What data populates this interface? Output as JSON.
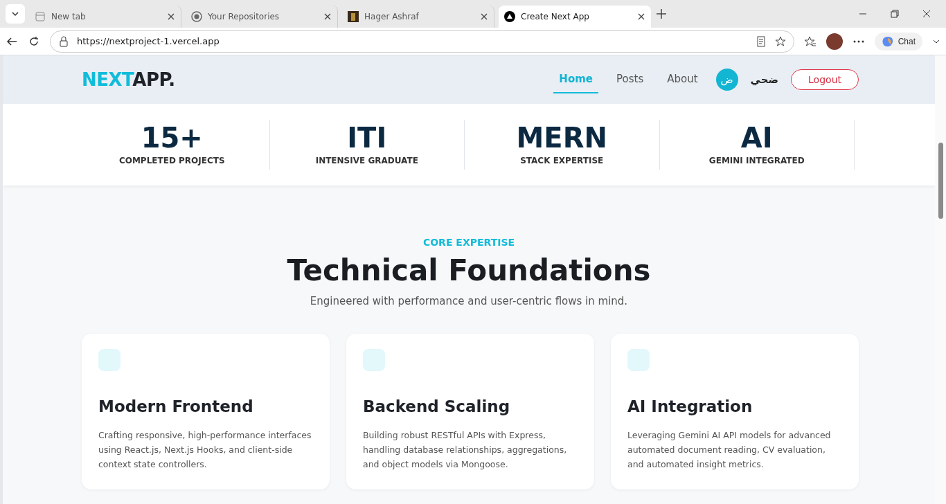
{
  "browser": {
    "tabs": [
      {
        "title": "New tab",
        "selected": false
      },
      {
        "title": "Your Repositories",
        "selected": false
      },
      {
        "title": "Hager Ashraf",
        "selected": false
      },
      {
        "title": "Create Next App",
        "selected": true
      }
    ],
    "url": "https://nextproject-1.vercel.app",
    "chat_label": "Chat"
  },
  "header": {
    "logo_accent": "NEXT",
    "logo_rest": "APP.",
    "nav": [
      {
        "label": "Home",
        "selected": true
      },
      {
        "label": "Posts",
        "selected": false
      },
      {
        "label": "About",
        "selected": false
      }
    ],
    "avatar_letter": "ض",
    "user_name": "ضحي",
    "logout": "Logout"
  },
  "stats": [
    {
      "value": "15+",
      "label": "COMPLETED PROJECTS"
    },
    {
      "value": "ITI",
      "label": "INTENSIVE GRADUATE"
    },
    {
      "value": "MERN",
      "label": "STACK EXPERTISE"
    },
    {
      "value": "AI",
      "label": "GEMINI INTEGRATED"
    }
  ],
  "section": {
    "eyebrow": "CORE EXPERTISE",
    "title": "Technical Foundations",
    "subtitle": "Engineered with performance and user-centric flows in mind."
  },
  "cards": [
    {
      "title": "Modern Frontend",
      "text": "Crafting responsive, high-performance interfaces using React.js, Next.js Hooks, and client-side context state controllers."
    },
    {
      "title": "Backend Scaling",
      "text": "Building robust RESTful APIs with Express, handling database relationships, aggregations, and object models via Mongoose."
    },
    {
      "title": "AI Integration",
      "text": "Leveraging Gemini AI API models for advanced automated document reading, CV evaluation, and automated insight metrics."
    }
  ]
}
